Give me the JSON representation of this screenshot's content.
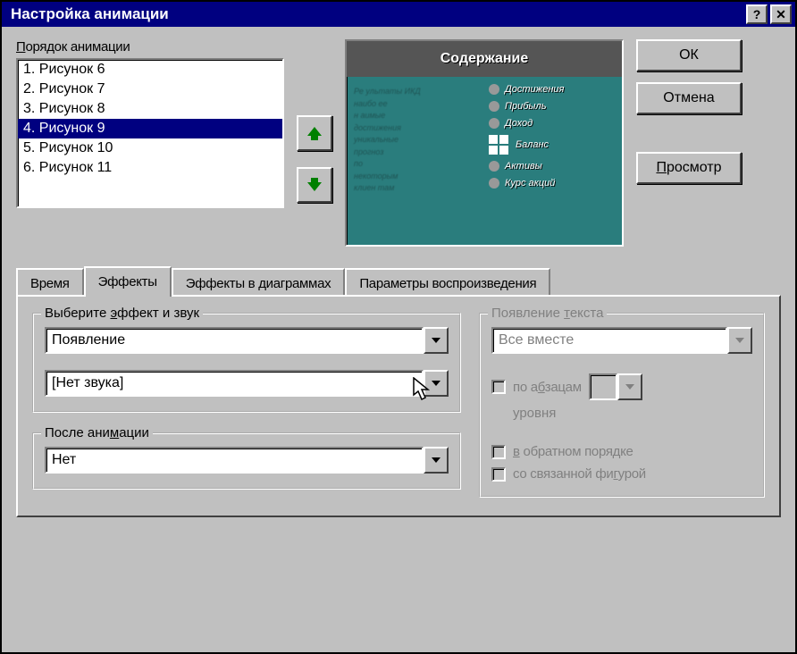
{
  "window": {
    "title": "Настройка анимации"
  },
  "titlebar": {
    "help": "?",
    "close": "✕"
  },
  "order": {
    "label": "Порядок анимации",
    "items": [
      {
        "label": "1. Рисунок 6"
      },
      {
        "label": "2. Рисунок 7"
      },
      {
        "label": "3. Рисунок 8"
      },
      {
        "label": "4. Рисунок 9"
      },
      {
        "label": "5. Рисунок 10"
      },
      {
        "label": "6. Рисунок 11"
      }
    ],
    "selected_index": 3
  },
  "preview": {
    "heading": "Содержание",
    "right_items": [
      "Достижения",
      "Прибыль",
      "Доход",
      "Баланс",
      "Активы",
      "Курс акций"
    ],
    "left_lines": [
      "Ре ультаты  ИКД",
      "наибо ее",
      "н аимые",
      "достижения",
      "уникальные",
      "прогноз",
      "по",
      "некоторым",
      "клиен там"
    ]
  },
  "buttons": {
    "ok": "ОК",
    "cancel": "Отмена",
    "preview": "Просмотр"
  },
  "tabs": {
    "time": "Время",
    "effects": "Эффекты",
    "chart_effects": "Эффекты в диаграммах",
    "playback": "Параметры воспроизведения"
  },
  "effect_group": {
    "legend": "Выберите эффект и звук",
    "effect": "Появление",
    "sound": "[Нет звука]"
  },
  "after_group": {
    "legend": "После анимации",
    "value": "Нет"
  },
  "text_group": {
    "legend": "Появление текста",
    "mode": "Все вместе",
    "by_para_label": "по абзацам",
    "level_label": "уровня",
    "reverse_label": "в обратном порядке",
    "linked_label": "со связанной фигурой"
  }
}
